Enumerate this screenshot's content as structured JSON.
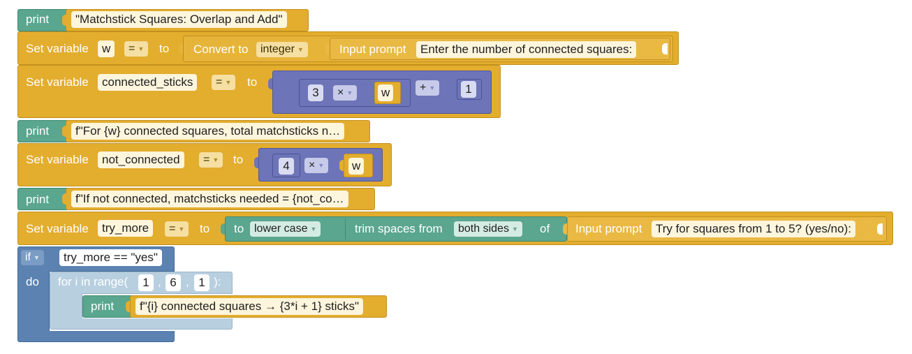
{
  "blocks": {
    "print1": {
      "keyword": "print",
      "text": "\"Matchstick Squares: Overlap and Add\""
    },
    "setw": {
      "keyword": "Set variable",
      "var": "w",
      "op": "=",
      "to": "to",
      "convert": "Convert to",
      "type": "integer",
      "input_label": "Input prompt",
      "prompt": "Enter the number of connected squares:"
    },
    "setcs": {
      "keyword": "Set variable",
      "var": "connected_sticks",
      "op": "=",
      "to": "to",
      "a": "3",
      "mul": "×",
      "w": "w",
      "add": "+",
      "b": "1"
    },
    "print2": {
      "keyword": "print",
      "text": "f\"For {w} connected squares, total matchsticks n…"
    },
    "setnc": {
      "keyword": "Set variable",
      "var": "not_connected",
      "op": "=",
      "to": "to",
      "a": "4",
      "mul": "×",
      "w": "w"
    },
    "print3": {
      "keyword": "print",
      "text": "f\"If not connected, matchsticks needed = {not_co…"
    },
    "settm": {
      "keyword": "Set variable",
      "var": "try_more",
      "op": "=",
      "to": "to",
      "to_kw": "to",
      "case": "lower case",
      "trim": "trim spaces from",
      "sides": "both sides",
      "of": "of",
      "input_label": "Input prompt",
      "prompt": "Try for squares from 1 to 5? (yes/no):"
    },
    "if": {
      "keyword": "if",
      "cond": "try_more == \"yes\"",
      "do": "do"
    },
    "for": {
      "head": "for i in range(",
      "start": "1",
      "sep1": ",",
      "stop": "6",
      "sep2": ",",
      "step": "1",
      "tail": "):"
    },
    "print4": {
      "keyword": "print",
      "text": "f\"{i} connected squares → {3*i + 1} sticks\""
    }
  },
  "colors": {
    "text_block": "#e3ad2e",
    "print_block": "#5aa68e",
    "math_block": "#6d74b8",
    "control_block": "#5b82b0"
  }
}
